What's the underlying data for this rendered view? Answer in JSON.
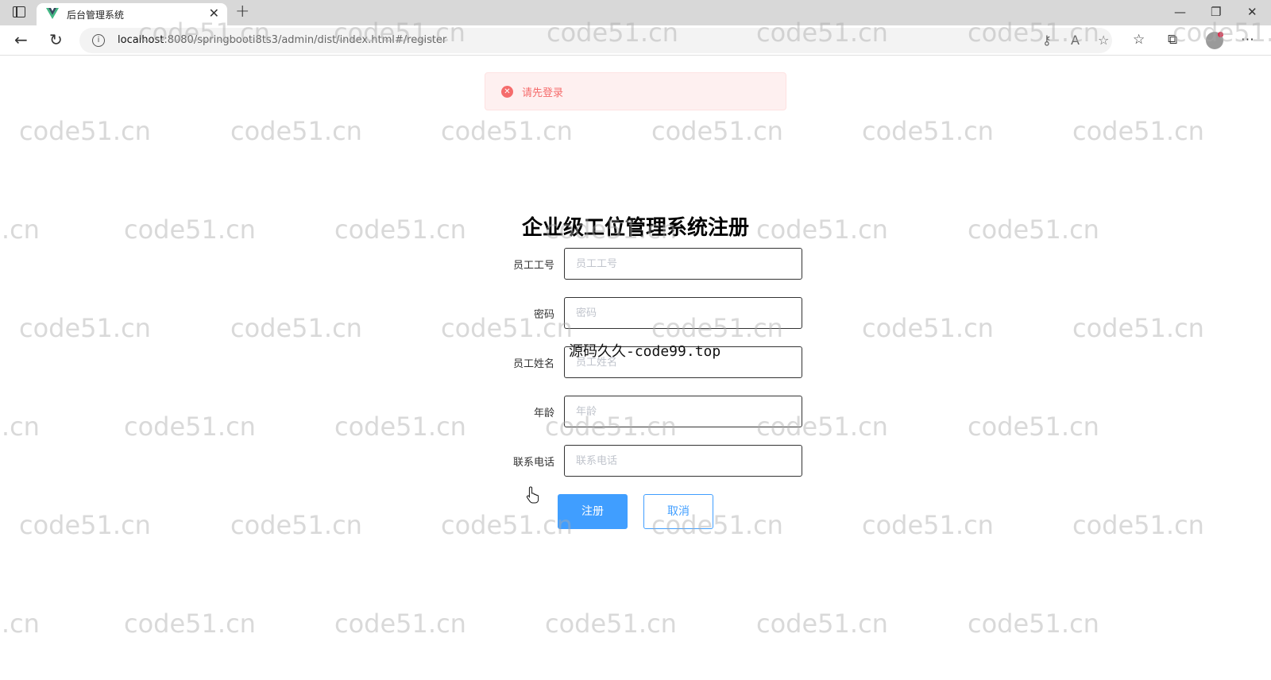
{
  "browser": {
    "tab_title": "后台管理系统",
    "url_host": "localhost",
    "url_rest": ":8080/springbooti8ts3/admin/dist/index.html#/register"
  },
  "message": {
    "text": "请先登录",
    "type": "error",
    "color": "#f56c6c"
  },
  "form": {
    "title": "企业级工位管理系统注册",
    "fields": [
      {
        "label": "员工工号",
        "placeholder": "员工工号",
        "value": ""
      },
      {
        "label": "密码",
        "placeholder": "密码",
        "value": ""
      },
      {
        "label": "员工姓名",
        "placeholder": "员工姓名",
        "value": ""
      },
      {
        "label": "年龄",
        "placeholder": "年龄",
        "value": ""
      },
      {
        "label": "联系电话",
        "placeholder": "联系电话",
        "value": ""
      }
    ],
    "submit_label": "注册",
    "cancel_label": "取消",
    "primary_color": "#409eff"
  },
  "overlay_text": "源码久久-code99.top",
  "watermark_text": "code51.cn"
}
